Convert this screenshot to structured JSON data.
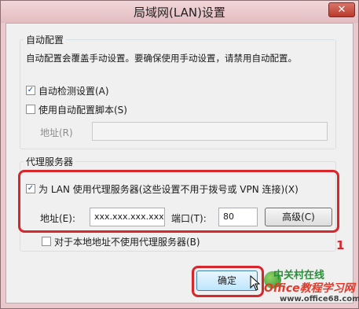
{
  "window": {
    "title": "局域网(LAN)设置",
    "close_glyph": "✕"
  },
  "auto_config": {
    "heading": "自动配置",
    "description": "自动配置会覆盖手动设置。要确保使用手动设置，请禁用自动配置。",
    "auto_detect": {
      "label": "自动检测设置(A)",
      "checked": true
    },
    "use_script": {
      "label": "使用自动配置脚本(S)",
      "checked": false
    },
    "address": {
      "label": "地址(R)",
      "value": ""
    }
  },
  "proxy": {
    "heading": "代理服务器",
    "use_proxy": {
      "label": "为 LAN 使用代理服务器(这些设置不用于拨号或 VPN 连接)(X)",
      "checked": true
    },
    "address_label": "地址(E):",
    "address_value": "xxx.xxx.xxx.xxx",
    "port_label": "端口(T):",
    "port_value": "80",
    "advanced_button": "高级(C)",
    "bypass_local": {
      "label": "对于本地地址不使用代理服务器(B)",
      "checked": false
    }
  },
  "annotation_number": "1",
  "buttons": {
    "ok": "确定"
  },
  "watermark": {
    "line1": "中关村在线",
    "line2": "Office教程学习网",
    "line3": "www.office68.com"
  },
  "colors": {
    "highlight": "#d8262d",
    "title_bar": "#e3bcc0",
    "accent": "#1b4f9c"
  }
}
